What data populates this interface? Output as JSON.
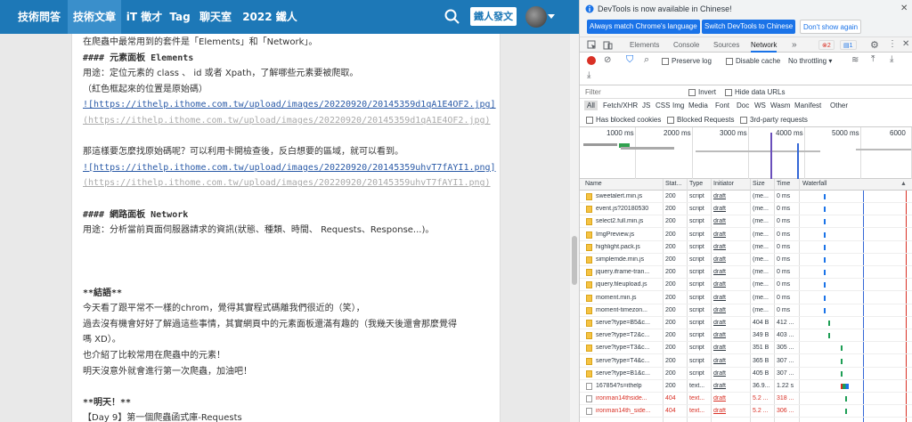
{
  "nav": {
    "items": [
      "技術問答",
      "技術文章",
      "iT 徵才",
      "Tag",
      "聊天室",
      "2022 鐵人賽"
    ],
    "active_index": 1,
    "post_button": "鐵人發文"
  },
  "editor": {
    "lines": [
      {
        "text": "在爬蟲中最常用到的套件是「Elements」和「Network」。",
        "style": ""
      },
      {
        "text": "#### 元素面板 Elements",
        "style": "mono bold"
      },
      {
        "text": "用途：定位元素的 class 、 id 或者 Xpath，了解哪些元素要被爬取。",
        "style": ""
      },
      {
        "text": "（紅色框起來的位置是原始碼）",
        "style": ""
      },
      {
        "text": "![https://ithelp.ithome.com.tw/upload/images/20220920/20145359d1qA1E4OF2.jpg]",
        "style": "link"
      },
      {
        "text": "(https://ithelp.ithome.com.tw/upload/images/20220920/20145359d1qA1E4OF2.jpg)",
        "style": "linkg"
      },
      {
        "text": "",
        "style": ""
      },
      {
        "text": "那這樣要怎麼找原始碼呢？可以利用卡開檢查後，反白想要的區域，就可以看到。",
        "style": ""
      },
      {
        "text": "![https://ithelp.ithome.com.tw/upload/images/20220920/20145359uhvT7fAYI1.png]",
        "style": "link"
      },
      {
        "text": "(https://ithelp.ithome.com.tw/upload/images/20220920/20145359uhvT7fAYI1.png)",
        "style": "linkg"
      },
      {
        "text": "",
        "style": ""
      },
      {
        "text": "#### 網路面板 Network",
        "style": "mono bold"
      },
      {
        "text": "用途：分析當前頁面伺服器請求的資訊(狀態、種類、時間、 Requests、Response...)。",
        "style": ""
      },
      {
        "text": "",
        "style": ""
      },
      {
        "text": "",
        "style": ""
      },
      {
        "text": "",
        "style": ""
      },
      {
        "text": "**結語**",
        "style": "mono bold"
      },
      {
        "text": "今天看了跟平常不一樣的chrom，覺得其實程式碼離我們很近的（笑），",
        "style": ""
      },
      {
        "text": "過去沒有機會好好了解過這些事情，其實網頁中的元素面板還滿有趣的（我幾天後還會那麼覺得",
        "style": ""
      },
      {
        "text": "嗎 XD）。",
        "style": ""
      },
      {
        "text": "也介紹了比較常用在爬蟲中的元素！",
        "style": ""
      },
      {
        "text": "明天沒意外就會進行第一次爬蟲，加油吧！",
        "style": ""
      },
      {
        "text": "",
        "style": ""
      },
      {
        "text": "**明天！**",
        "style": "mono bold"
      },
      {
        "text": "【Day 9】第一個爬蟲函式庫-Requests",
        "style": ""
      }
    ]
  },
  "devtools": {
    "notice": "DevTools is now available in Chinese!",
    "btn_match": "Always match Chrome's language",
    "btn_switch": "Switch DevTools to Chinese",
    "btn_dismiss": "Don't show again",
    "tabs": [
      "Elements",
      "Console",
      "Sources",
      "Network"
    ],
    "more_tabs": "»",
    "error_count": "2",
    "message_count": "1",
    "preserve_log": "Preserve log",
    "disable_cache": "Disable cache",
    "throttling": "No throttling",
    "filter_placeholder": "Filter",
    "invert": "Invert",
    "hide_data_urls": "Hide data URLs",
    "types": [
      "All",
      "Fetch/XHR",
      "JS",
      "CSS",
      "Img",
      "Media",
      "Font",
      "Doc",
      "WS",
      "Wasm",
      "Manifest",
      "Other"
    ],
    "has_blocked_cookies": "Has blocked cookies",
    "blocked_requests": "Blocked Requests",
    "third_party": "3rd-party requests",
    "overview_ticks": [
      "1000 ms",
      "2000 ms",
      "3000 ms",
      "4000 ms",
      "5000 ms",
      "6000"
    ],
    "columns": [
      "Name",
      "Stat...",
      "Type",
      "Initiator",
      "Size",
      "Time",
      "Waterfall"
    ],
    "rows": [
      {
        "name": "sweetalert.min.js",
        "status": "200",
        "type": "script",
        "initiator": "draft",
        "size": "(me...",
        "time": "0 ms",
        "err": false,
        "doc": false,
        "wf": 0.05,
        "ww": 0.01
      },
      {
        "name": "event.js?20180530",
        "status": "200",
        "type": "script",
        "initiator": "draft",
        "size": "(me...",
        "time": "0 ms",
        "err": false,
        "doc": false,
        "wf": 0.05,
        "ww": 0.01
      },
      {
        "name": "select2.full.min.js",
        "status": "200",
        "type": "script",
        "initiator": "draft",
        "size": "(me...",
        "time": "0 ms",
        "err": false,
        "doc": false,
        "wf": 0.05,
        "ww": 0.01
      },
      {
        "name": "ImgPreview.js",
        "status": "200",
        "type": "script",
        "initiator": "draft",
        "size": "(me...",
        "time": "0 ms",
        "err": false,
        "doc": false,
        "wf": 0.05,
        "ww": 0.01
      },
      {
        "name": "highlight.pack.js",
        "status": "200",
        "type": "script",
        "initiator": "draft",
        "size": "(me...",
        "time": "0 ms",
        "err": false,
        "doc": false,
        "wf": 0.05,
        "ww": 0.01
      },
      {
        "name": "simplemde.min.js",
        "status": "200",
        "type": "script",
        "initiator": "draft",
        "size": "(me...",
        "time": "0 ms",
        "err": false,
        "doc": false,
        "wf": 0.05,
        "ww": 0.01
      },
      {
        "name": "jquery.iframe-tran...",
        "status": "200",
        "type": "script",
        "initiator": "draft",
        "size": "(me...",
        "time": "0 ms",
        "err": false,
        "doc": false,
        "wf": 0.05,
        "ww": 0.01
      },
      {
        "name": "jquery.fileupload.js",
        "status": "200",
        "type": "script",
        "initiator": "draft",
        "size": "(me...",
        "time": "0 ms",
        "err": false,
        "doc": false,
        "wf": 0.05,
        "ww": 0.01
      },
      {
        "name": "moment.min.js",
        "status": "200",
        "type": "script",
        "initiator": "draft",
        "size": "(me...",
        "time": "0 ms",
        "err": false,
        "doc": false,
        "wf": 0.05,
        "ww": 0.01
      },
      {
        "name": "moment-timezon...",
        "status": "200",
        "type": "script",
        "initiator": "draft",
        "size": "(me...",
        "time": "0 ms",
        "err": false,
        "doc": false,
        "wf": 0.05,
        "ww": 0.01
      },
      {
        "name": "serve?type=B5&c...",
        "status": "200",
        "type": "script",
        "initiator": "draft",
        "size": "404 B",
        "time": "412 ...",
        "err": false,
        "doc": false,
        "wf": 0.06,
        "ww": 0.06
      },
      {
        "name": "serve?type=T2&c...",
        "status": "200",
        "type": "script",
        "initiator": "draft",
        "size": "349 B",
        "time": "403 ...",
        "err": false,
        "doc": false,
        "wf": 0.06,
        "ww": 0.06
      },
      {
        "name": "serve?type=T3&c...",
        "status": "200",
        "type": "script",
        "initiator": "draft",
        "size": "351 B",
        "time": "305 ...",
        "err": false,
        "doc": false,
        "wf": 0.09,
        "ww": 0.05
      },
      {
        "name": "serve?type=T4&c...",
        "status": "200",
        "type": "script",
        "initiator": "draft",
        "size": "365 B",
        "time": "307 ...",
        "err": false,
        "doc": false,
        "wf": 0.09,
        "ww": 0.05
      },
      {
        "name": "serve?type=B1&c...",
        "status": "200",
        "type": "script",
        "initiator": "draft",
        "size": "405 B",
        "time": "307 ...",
        "err": false,
        "doc": false,
        "wf": 0.09,
        "ww": 0.05
      },
      {
        "name": "167854?s=ithelp",
        "status": "200",
        "type": "text...",
        "initiator": "draft",
        "size": "36.9...",
        "time": "1.22 s",
        "err": false,
        "doc": true,
        "wf": 0.09,
        "ww": 0.2
      },
      {
        "name": "ironman14thside...",
        "status": "404",
        "type": "text...",
        "initiator": "draft",
        "size": "5.2 ...",
        "time": "318 ...",
        "err": true,
        "doc": true,
        "wf": 0.1,
        "ww": 0.05
      },
      {
        "name": "ironman14th_side...",
        "status": "404",
        "type": "text...",
        "initiator": "draft",
        "size": "5.2 ...",
        "time": "306 ...",
        "err": true,
        "doc": true,
        "wf": 0.1,
        "ww": 0.05
      }
    ]
  }
}
